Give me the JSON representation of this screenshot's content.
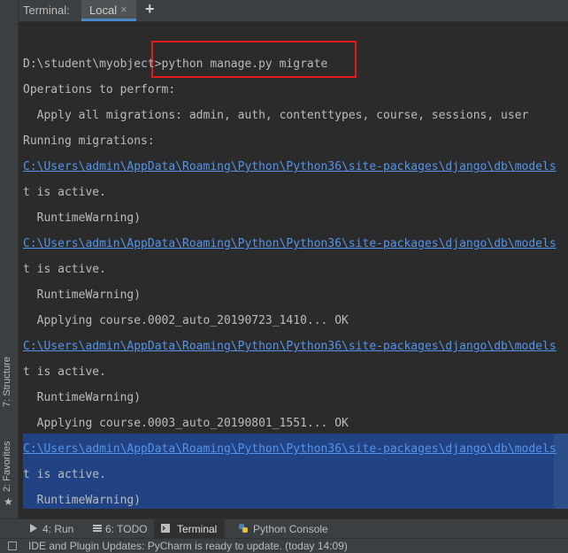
{
  "tabs": {
    "panel_title": "Terminal:",
    "active_tab": "Local",
    "close_glyph": "×",
    "add_glyph": "+"
  },
  "sidebar": {
    "structure": "7: Structure",
    "favorites": "2: Favorites",
    "star": "★"
  },
  "terminal": {
    "lines": [
      {
        "text": "D:\\student\\myobject>python manage.py migrate",
        "link": false
      },
      {
        "text": "Operations to perform:",
        "link": false
      },
      {
        "text": "  Apply all migrations: admin, auth, contenttypes, course, sessions, user",
        "link": false
      },
      {
        "text": "Running migrations:",
        "link": false
      },
      {
        "text": "C:\\Users\\admin\\AppData\\Roaming\\Python\\Python36\\site-packages\\django\\db\\models",
        "link": true
      },
      {
        "text": "t is active.",
        "link": false
      },
      {
        "text": "  RuntimeWarning)",
        "link": false
      },
      {
        "text": "C:\\Users\\admin\\AppData\\Roaming\\Python\\Python36\\site-packages\\django\\db\\models",
        "link": true
      },
      {
        "text": "t is active.",
        "link": false
      },
      {
        "text": "  RuntimeWarning)",
        "link": false
      },
      {
        "text": "  Applying course.0002_auto_20190723_1410... OK",
        "link": false
      },
      {
        "text": "C:\\Users\\admin\\AppData\\Roaming\\Python\\Python36\\site-packages\\django\\db\\models",
        "link": true
      },
      {
        "text": "t is active.",
        "link": false
      },
      {
        "text": "  RuntimeWarning)",
        "link": false
      },
      {
        "text": "  Applying course.0003_auto_20190801_1551... OK",
        "link": false
      },
      {
        "text": "C:\\Users\\admin\\AppData\\Roaming\\Python\\Python36\\site-packages\\django\\db\\models",
        "link": true
      },
      {
        "text": "t is active.",
        "link": false
      },
      {
        "text": "  RuntimeWarning)",
        "link": false
      }
    ]
  },
  "toolwindows": {
    "run": "4: Run",
    "todo": "6: TODO",
    "terminal": "Terminal",
    "python_console": "Python Console"
  },
  "status": {
    "message": "IDE and Plugin Updates: PyCharm is ready to update. (today 14:09)"
  },
  "colors": {
    "background": "#2b2b2b",
    "link": "#5394ec",
    "selection": "#214283",
    "annotation": "#e31b1b"
  }
}
